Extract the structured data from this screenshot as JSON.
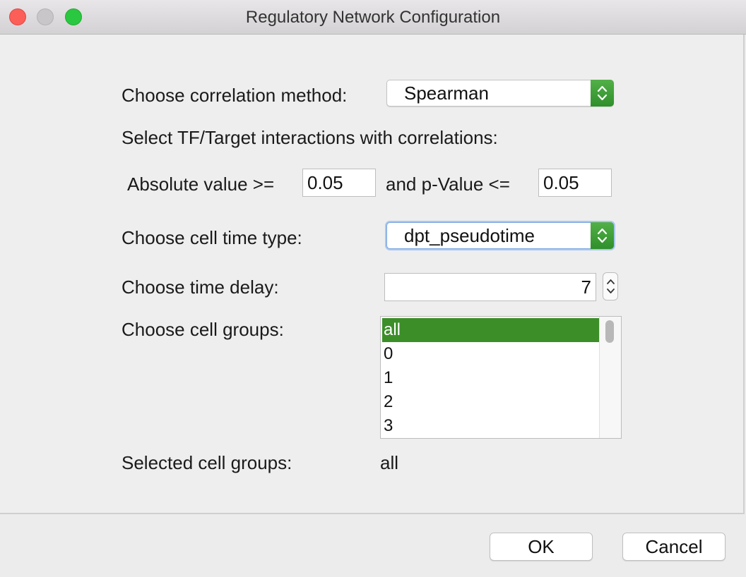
{
  "window": {
    "title": "Regulatory Network Configuration"
  },
  "form": {
    "correlation_method_label": "Choose correlation method:",
    "correlation_method_value": "Spearman",
    "select_interactions_label": "Select TF/Target interactions with correlations:",
    "absolute_value_label": "Absolute value >=",
    "absolute_value": "0.05",
    "pvalue_label": "and p-Value <=",
    "pvalue": "0.05",
    "cell_time_type_label": "Choose cell time type:",
    "cell_time_type_value": "dpt_pseudotime",
    "time_delay_label": "Choose time delay:",
    "time_delay_value": "7",
    "cell_groups_label": "Choose cell groups:",
    "cell_groups": [
      "all",
      "0",
      "1",
      "2",
      "3"
    ],
    "cell_groups_selected_index": 0,
    "selected_cell_groups_label": "Selected cell groups:",
    "selected_cell_groups_value": "all"
  },
  "buttons": {
    "ok": "OK",
    "cancel": "Cancel"
  },
  "colors": {
    "accent_green": "#3c8e29",
    "close": "#fc5f57",
    "maximize": "#2ac840",
    "focus_ring": "#a9c7f0"
  }
}
